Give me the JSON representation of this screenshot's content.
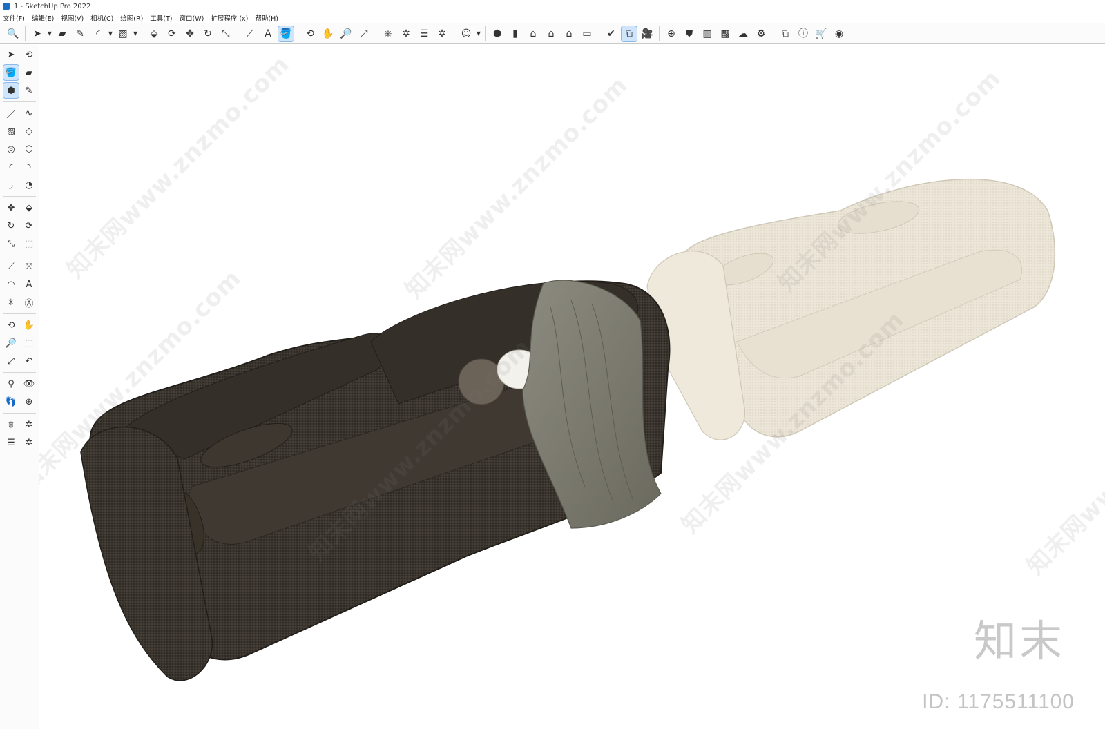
{
  "window": {
    "title": "1 - SketchUp Pro 2022"
  },
  "menu": [
    "文件(F)",
    "编辑(E)",
    "视图(V)",
    "相机(C)",
    "绘图(R)",
    "工具(T)",
    "窗口(W)",
    "扩展程序 (x)",
    "帮助(H)"
  ],
  "toolbar_icons": [
    {
      "name": "search-icon",
      "glyph": "🔍"
    },
    {
      "name": "select-icon",
      "glyph": "➤"
    },
    {
      "name": "eraser-icon",
      "glyph": "▰"
    },
    {
      "name": "pencil-icon",
      "glyph": "✎"
    },
    {
      "name": "arc-icon",
      "glyph": "◜"
    },
    {
      "name": "rectangle-icon",
      "glyph": "▨"
    },
    {
      "name": "push-pull-icon",
      "glyph": "⬙"
    },
    {
      "name": "follow-me-icon",
      "glyph": "⟳"
    },
    {
      "name": "move-icon",
      "glyph": "✥"
    },
    {
      "name": "rotate-icon",
      "glyph": "↻"
    },
    {
      "name": "scale-icon",
      "glyph": "⤡"
    },
    {
      "name": "tape-measure-icon",
      "glyph": "⟋"
    },
    {
      "name": "text-icon",
      "glyph": "A"
    },
    {
      "name": "paint-bucket-icon",
      "glyph": "🪣"
    },
    {
      "name": "orbit-icon",
      "glyph": "⟲"
    },
    {
      "name": "pan-icon",
      "glyph": "✋"
    },
    {
      "name": "zoom-icon",
      "glyph": "🔎"
    },
    {
      "name": "zoom-extents-icon",
      "glyph": "⤢"
    },
    {
      "name": "warehouse-icon",
      "glyph": "⎈"
    },
    {
      "name": "extension-icon",
      "glyph": "✲"
    },
    {
      "name": "layers-icon",
      "glyph": "☰"
    },
    {
      "name": "sandbox-icon",
      "glyph": "✲"
    },
    {
      "name": "account-icon",
      "glyph": "☺"
    },
    {
      "name": "iso-view-icon",
      "glyph": "⬢"
    },
    {
      "name": "front-view-icon",
      "glyph": "▮"
    },
    {
      "name": "home-icon",
      "glyph": "⌂"
    },
    {
      "name": "house-icon",
      "glyph": "⌂"
    },
    {
      "name": "outline-house-icon",
      "glyph": "⌂"
    },
    {
      "name": "box-icon",
      "glyph": "▭"
    },
    {
      "name": "style-icon",
      "glyph": "✔"
    },
    {
      "name": "section-icon",
      "glyph": "⧉"
    },
    {
      "name": "camera-icon",
      "glyph": "🎥"
    },
    {
      "name": "add-icon",
      "glyph": "⊕"
    },
    {
      "name": "shield-icon",
      "glyph": "⛊"
    },
    {
      "name": "chart-icon",
      "glyph": "▥"
    },
    {
      "name": "checker-icon",
      "glyph": "▩"
    },
    {
      "name": "cloud-icon",
      "glyph": "☁"
    },
    {
      "name": "settings-icon",
      "glyph": "⚙"
    },
    {
      "name": "window-icon",
      "glyph": "⧉"
    },
    {
      "name": "info-icon",
      "glyph": "ⓘ"
    },
    {
      "name": "cart-icon",
      "glyph": "🛒"
    },
    {
      "name": "profile-icon",
      "glyph": "◉"
    }
  ],
  "left_tools": [
    [
      "select-icon",
      "orbit-icon"
    ],
    [
      "paint-bucket-icon",
      "eraser-icon"
    ],
    [
      "component-icon",
      "pencil-icon"
    ],
    [
      "line-icon",
      "freehand-icon"
    ],
    [
      "rectangle-icon",
      "rotated-rect-icon"
    ],
    [
      "circle-icon",
      "polygon-icon"
    ],
    [
      "arc-icon",
      "arc2-icon"
    ],
    [
      "arc3-icon",
      "pie-icon"
    ],
    [
      "move-icon",
      "push-pull-icon"
    ],
    [
      "rotate-icon",
      "follow-me-icon"
    ],
    [
      "scale-icon",
      "offset-icon"
    ],
    [
      "tape-icon",
      "dimension-icon"
    ],
    [
      "protractor-icon",
      "text-icon"
    ],
    [
      "axes-icon",
      "3d-text-icon"
    ],
    [
      "orbit-icon",
      "pan-icon"
    ],
    [
      "zoom-icon",
      "zoom-window-icon"
    ],
    [
      "zoom-extents-icon",
      "previous-view-icon"
    ],
    [
      "position-camera-icon",
      "look-around-icon"
    ],
    [
      "walk-icon",
      "section-plane-icon"
    ],
    [
      "warehouse-icon",
      "extension-icon"
    ],
    [
      "layers-icon",
      "sandbox-icon"
    ]
  ],
  "glyph_map": {
    "select-icon": "➤",
    "orbit-icon": "⟲",
    "paint-bucket-icon": "🪣",
    "eraser-icon": "▰",
    "component-icon": "⬢",
    "pencil-icon": "✎",
    "line-icon": "／",
    "freehand-icon": "∿",
    "rectangle-icon": "▨",
    "rotated-rect-icon": "◇",
    "circle-icon": "◎",
    "polygon-icon": "⬡",
    "arc-icon": "◜",
    "arc2-icon": "◝",
    "arc3-icon": "◞",
    "pie-icon": "◔",
    "move-icon": "✥",
    "push-pull-icon": "⬙",
    "rotate-icon": "↻",
    "follow-me-icon": "⟳",
    "scale-icon": "⤡",
    "offset-icon": "⬚",
    "tape-icon": "⟋",
    "dimension-icon": "⤧",
    "protractor-icon": "◠",
    "text-icon": "A",
    "axes-icon": "✳",
    "3d-text-icon": "Ⓐ",
    "pan-icon": "✋",
    "zoom-icon": "🔎",
    "zoom-window-icon": "⬚",
    "zoom-extents-icon": "⤢",
    "previous-view-icon": "↶",
    "position-camera-icon": "⚲",
    "look-around-icon": "👁",
    "walk-icon": "👣",
    "section-plane-icon": "⊕",
    "warehouse-icon": "⎈",
    "extension-icon": "✲",
    "layers-icon": "☰",
    "sandbox-icon": "✲"
  },
  "watermark_text": "知末网www.znzmo.com",
  "brand_text": "知末",
  "image_id": "ID: 1175511100",
  "colors": {
    "dark_sofa": "#3a352e",
    "light_sofa": "#ece6d8",
    "throw": "#7f7e72",
    "accent": "#1b6ec2"
  }
}
